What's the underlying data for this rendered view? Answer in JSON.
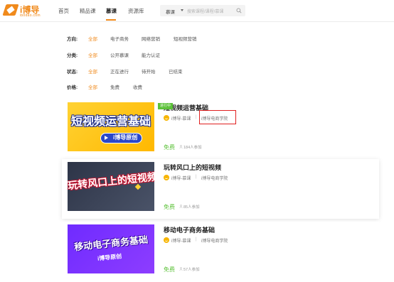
{
  "logo": {
    "text": "i博导",
    "subtitle": "ibodao.com"
  },
  "nav": {
    "items": [
      "首页",
      "精品课",
      "慕课",
      "资源库"
    ],
    "active_index": 2
  },
  "search": {
    "category": "慕课",
    "placeholder": "搜索课程/课程/慕课"
  },
  "filters": [
    {
      "label": "方向:",
      "options": [
        "全部",
        "电子商务",
        "网络营销",
        "短视频营销"
      ],
      "active": "全部"
    },
    {
      "label": "分类:",
      "options": [
        "全部",
        "公开慕课",
        "能力认证"
      ],
      "active": "全部"
    },
    {
      "label": "状态:",
      "options": [
        "全部",
        "正在进行",
        "待开始",
        "已结束"
      ],
      "active": "全部"
    },
    {
      "label": "价格:",
      "options": [
        "全部",
        "免费",
        "收费"
      ],
      "active": "全部"
    }
  ],
  "courses": [
    {
      "title": "短视频运营基础",
      "thumb_title": "短视频运营基础",
      "thumb_caption": "i博导原创",
      "status": "进行中",
      "provider": "i博导-慕课",
      "school": "i博导电商学院",
      "price": "免费",
      "enrolled": "184人参加"
    },
    {
      "title": "玩转风口上的短视频",
      "thumb_title": "玩转风口上的短视频",
      "provider": "i博导-慕课",
      "school": "i博导电商学院",
      "price": "免费",
      "enrolled": "85人参加"
    },
    {
      "title": "移动电子商务基础",
      "thumb_title": "移动电子商务基础",
      "thumb_caption": "i博导原创",
      "provider": "i博导-慕课",
      "school": "i博导电商学院",
      "price": "免费",
      "enrolled": "57人参加"
    }
  ],
  "colors": {
    "accent": "#f08a1c",
    "price": "#5dc23a",
    "highlight": "#e02020"
  }
}
